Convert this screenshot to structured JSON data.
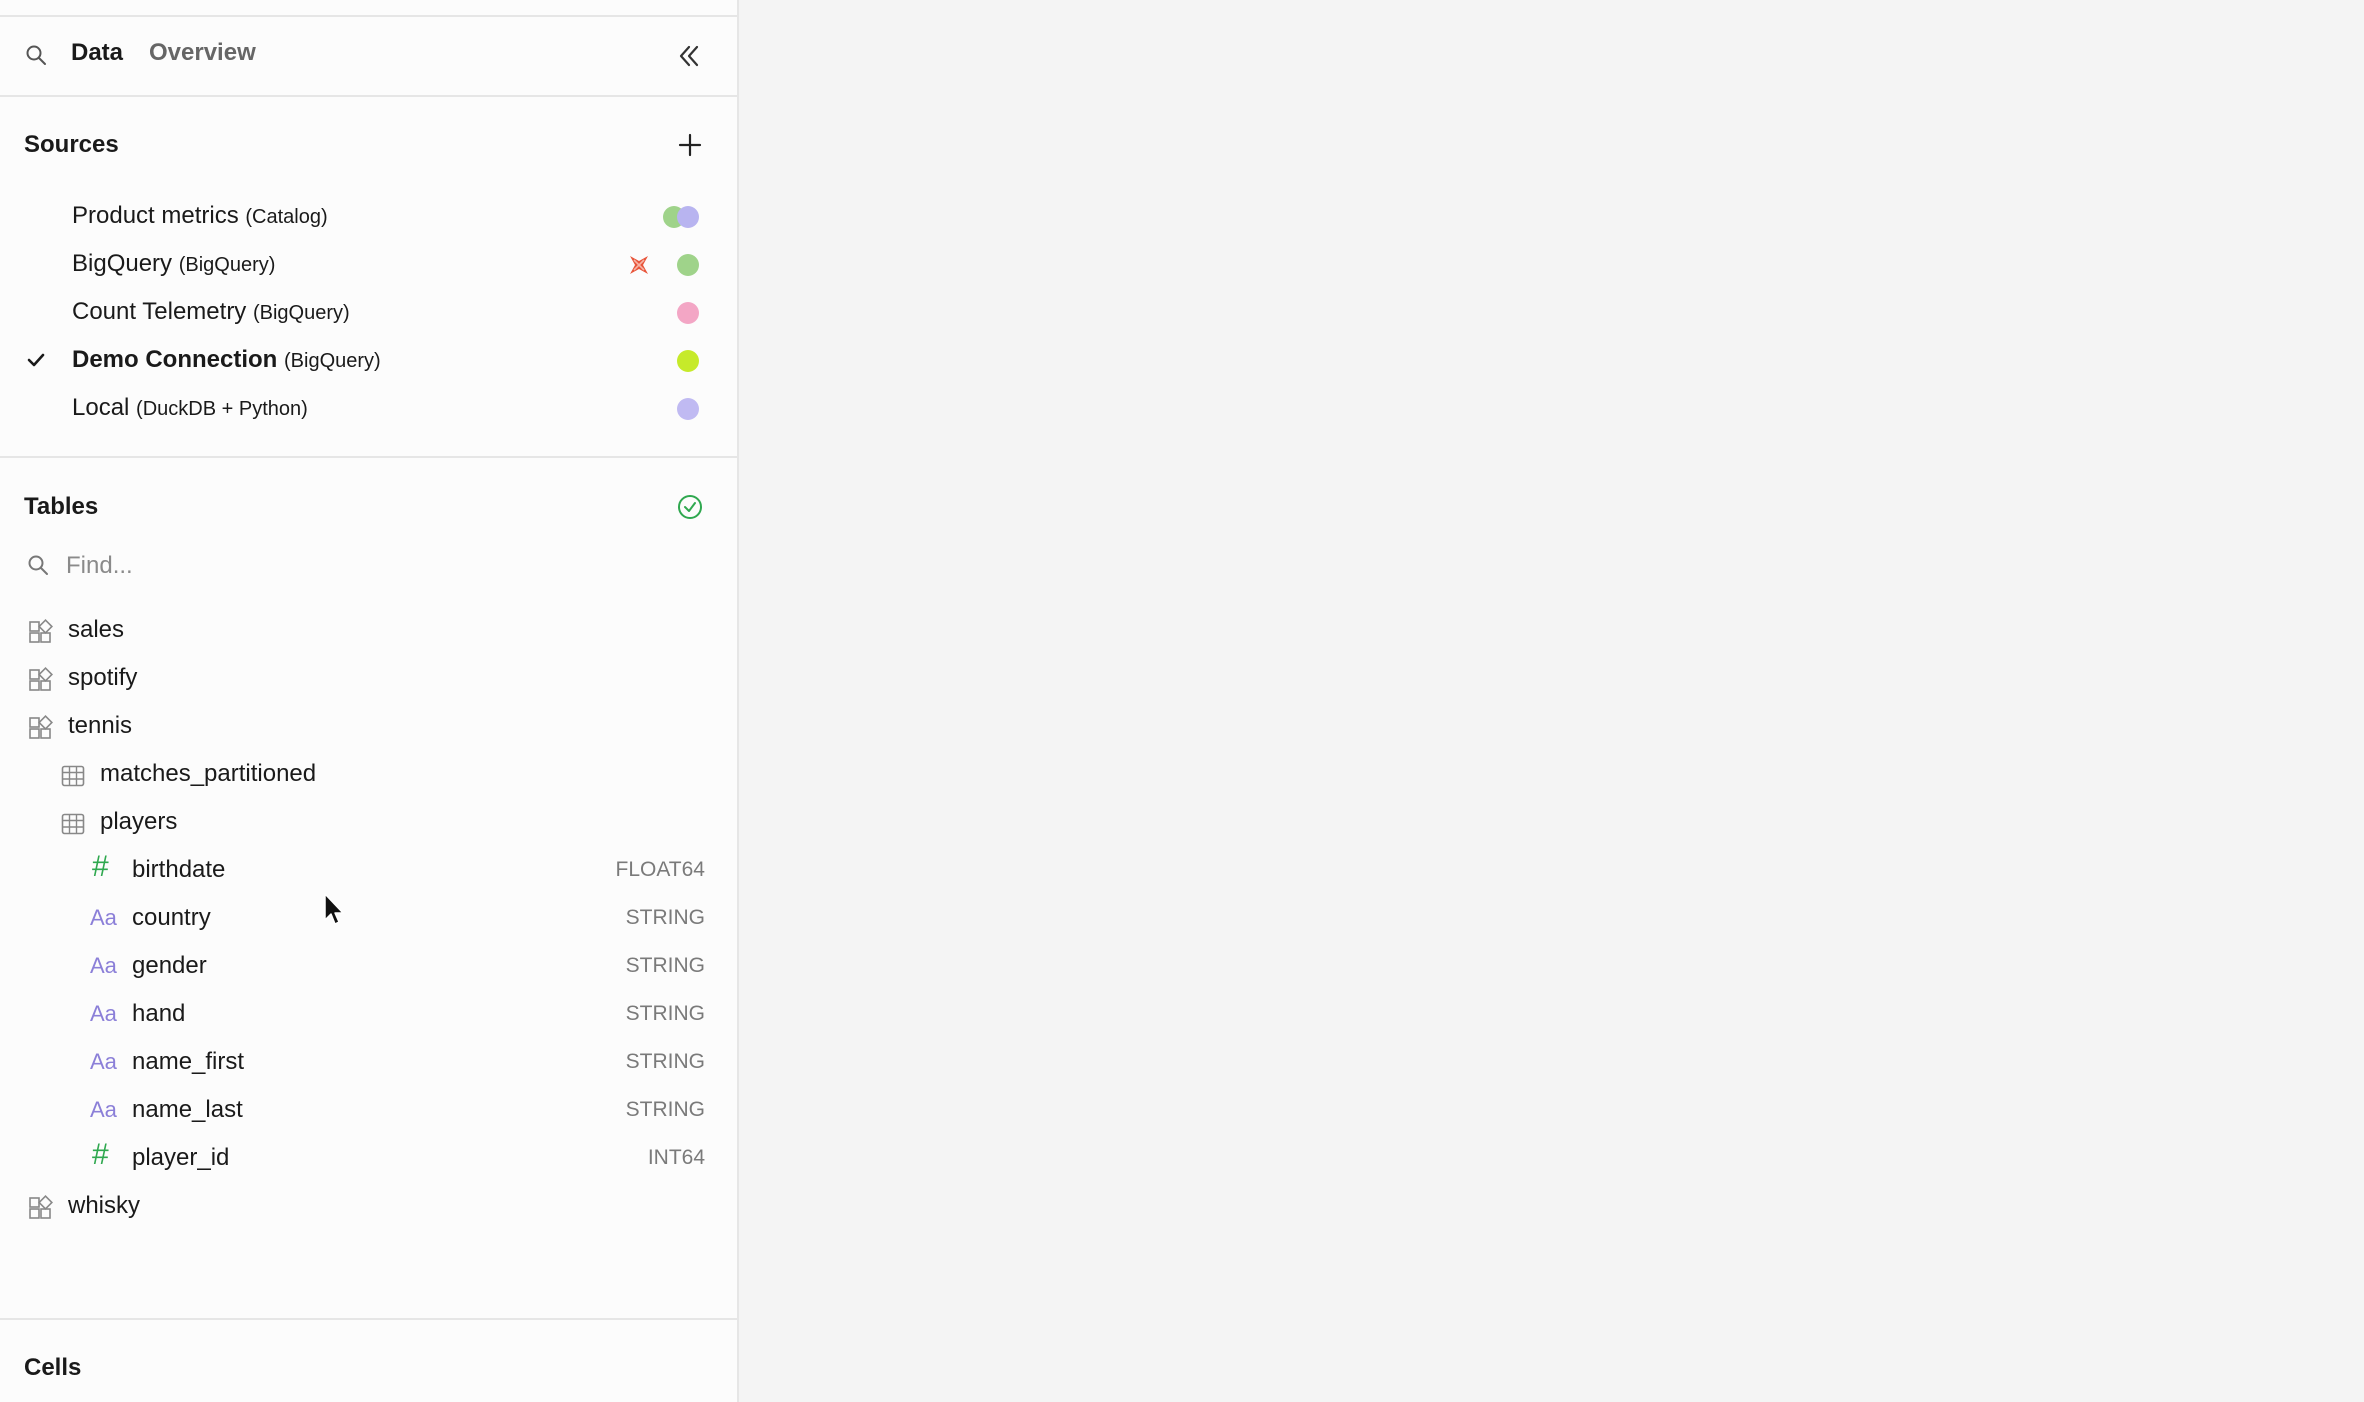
{
  "header": {
    "tab_data": "Data",
    "tab_overview": "Overview"
  },
  "sources": {
    "title": "Sources",
    "items": [
      {
        "name": "Product metrics",
        "type": "(Catalog)",
        "dot_color": "#b8b4f0",
        "dot2_color": "#9fd38a",
        "active": false
      },
      {
        "name": "BigQuery",
        "type": "(BigQuery)",
        "dot_color": "#9fd38a",
        "flag": "error-icon",
        "active": false
      },
      {
        "name": "Count Telemetry",
        "type": "(BigQuery)",
        "dot_color": "#f3a6c5",
        "active": false
      },
      {
        "name": "Demo Connection",
        "type": "(BigQuery)",
        "dot_color": "#c6ea2a",
        "active": true
      },
      {
        "name": "Local",
        "type": "(DuckDB + Python)",
        "dot_color": "#c0baf2",
        "active": false
      }
    ]
  },
  "tables": {
    "title": "Tables",
    "search_placeholder": "Find...",
    "schemas": [
      {
        "name": "sales"
      },
      {
        "name": "spotify"
      },
      {
        "name": "tennis"
      }
    ],
    "tennis_tables": [
      {
        "name": "matches_partitioned"
      },
      {
        "name": "players"
      }
    ],
    "player_columns": [
      {
        "name": "birthdate",
        "type": "FLOAT64",
        "kind": "number-icon"
      },
      {
        "name": "country",
        "type": "STRING",
        "kind": "text-icon"
      },
      {
        "name": "gender",
        "type": "STRING",
        "kind": "text-icon"
      },
      {
        "name": "hand",
        "type": "STRING",
        "kind": "text-icon"
      },
      {
        "name": "name_first",
        "type": "STRING",
        "kind": "text-icon"
      },
      {
        "name": "name_last",
        "type": "STRING",
        "kind": "text-icon"
      },
      {
        "name": "player_id",
        "type": "INT64",
        "kind": "number-icon"
      }
    ],
    "last_schema": {
      "name": "whisky"
    }
  },
  "cells": {
    "title": "Cells"
  },
  "icons": {
    "text_glyph": "Aa",
    "number_glyph": "#"
  }
}
